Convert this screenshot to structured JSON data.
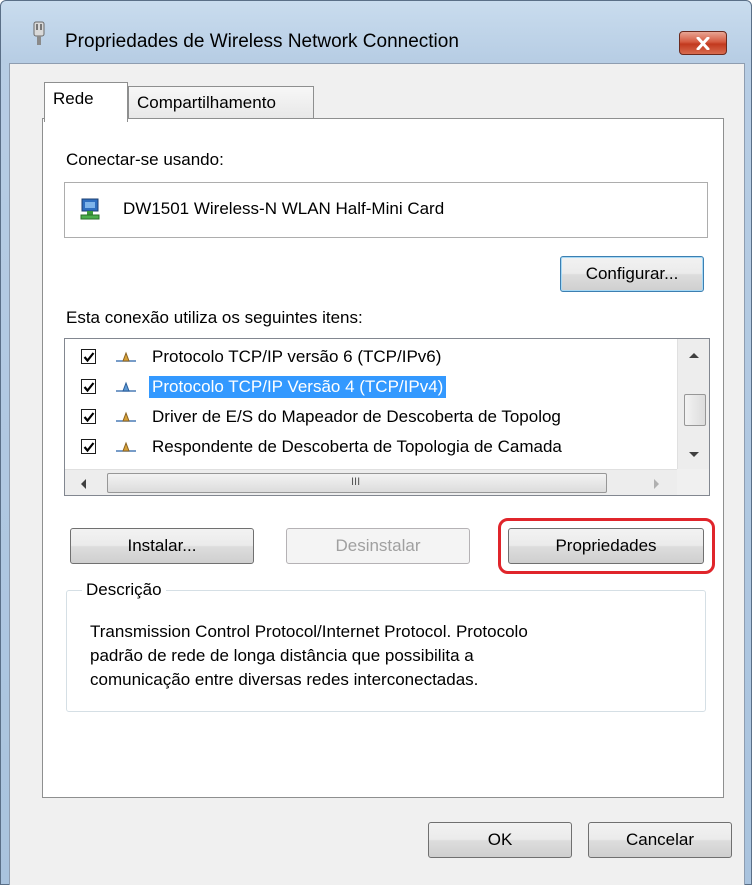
{
  "window": {
    "title": "Propriedades de Wireless Network Connection"
  },
  "tabs": [
    {
      "label": "Rede",
      "active": true
    },
    {
      "label": "Compartilhamento",
      "active": false
    }
  ],
  "connect_using": {
    "label": "Conectar-se usando:",
    "adapter_name": "DW1501 Wireless-N WLAN Half-Mini Card"
  },
  "configure_button": "Configurar...",
  "items_label": "Esta conexão utiliza os seguintes itens:",
  "items": [
    {
      "label": "Protocolo TCP/IP versão 6 (TCP/IPv6)",
      "checked": true,
      "selected": false
    },
    {
      "label": "Protocolo TCP/IP Versão 4 (TCP/IPv4)",
      "checked": true,
      "selected": true
    },
    {
      "label": "Driver de E/S do Mapeador de Descoberta de Topolog",
      "checked": true,
      "selected": false
    },
    {
      "label": "Respondente de Descoberta de Topologia de Camada",
      "checked": true,
      "selected": false
    }
  ],
  "hscroll_grip": "III",
  "buttons": {
    "install": "Instalar...",
    "uninstall": "Desinstalar",
    "properties": "Propriedades",
    "ok": "OK",
    "cancel": "Cancelar"
  },
  "description": {
    "legend": "Descrição",
    "lines": [
      "Transmission Control Protocol/Internet Protocol. Protocolo",
      "padrão de rede de longa distância que possibilita a",
      "comunicação entre diversas redes interconectadas."
    ]
  },
  "colors": {
    "selection": "#3399ff",
    "highlight_ring": "#e0252b",
    "close_button": "#c2391e"
  }
}
